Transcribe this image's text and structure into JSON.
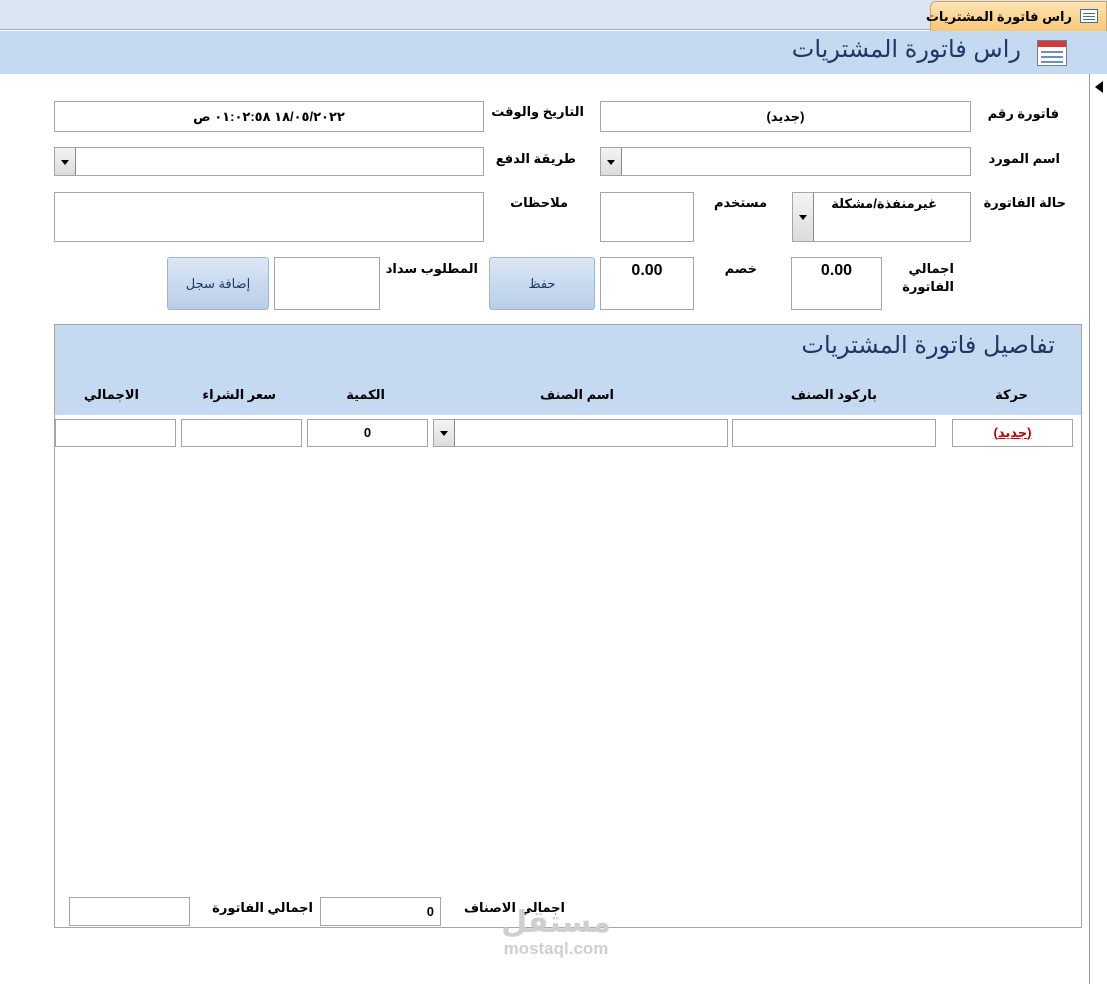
{
  "tab": {
    "label": "راس فاتورة المشتريات",
    "icon": "form-icon"
  },
  "header": {
    "title": "راس فاتورة المشتريات",
    "icon": "form-icon"
  },
  "fields": {
    "invoice_number_label": "فاتورة رقم",
    "invoice_number_value": "(جديد)",
    "datetime_label": "التاريخ والوقت",
    "datetime_value": "١٨/٠٥/٢٠٢٢ ٠١:٠٢:٥٨ ص",
    "supplier_label": "اسم المورد",
    "supplier_value": "",
    "payment_method_label": "طريقة الدفع",
    "payment_method_value": "",
    "invoice_status_label": "حالة الفاتورة",
    "invoice_status_value": "غيرمنفذة/مشكلة",
    "user_label": "مستخدم",
    "user_value": "",
    "notes_label": "ملاحظات",
    "notes_value": "",
    "invoice_total_label": "اجمالي الفاتورة",
    "invoice_total_value": "0.00",
    "discount_label": "خصم",
    "discount_value": "0.00",
    "amount_due_label": "المطلوب سداد",
    "amount_due_value": ""
  },
  "buttons": {
    "save": "حفظ",
    "add_record": "إضافة سجل"
  },
  "details": {
    "title": "تفاصيل فاتورة المشتريات",
    "columns": {
      "action": "حركة",
      "barcode": "باركود الصنف",
      "item_name": "اسم الصنف",
      "quantity": "الكمية",
      "purchase_price": "سعر الشراء",
      "total": "الاجمالي"
    },
    "new_row": {
      "action": "(جديد)",
      "barcode": "",
      "item_name": "",
      "quantity": "0",
      "purchase_price": "",
      "total": ""
    },
    "footer": {
      "items_total_label": "اجمالي الاصناف",
      "items_total_value": "0",
      "invoice_total_label": "اجمالي الفاتورة",
      "invoice_total_value": ""
    }
  },
  "watermark": {
    "arabic": "مستقل",
    "latin": "mostaql.com"
  },
  "colors": {
    "header_bg": "#c5d9f1",
    "title_text": "#1f3864",
    "tab_bg": "#f8c878",
    "new_link": "#c00000"
  }
}
